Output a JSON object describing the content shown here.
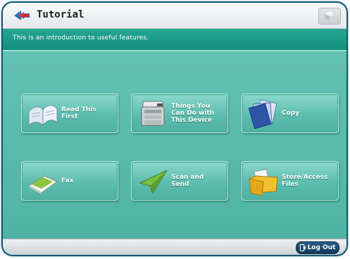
{
  "window": {
    "title": "Tutorial",
    "title_icon": "tutorial-pointer-icon",
    "settings_icon": "settings-cube-icon"
  },
  "info": {
    "text": "This is an introduction to useful features."
  },
  "tiles": [
    {
      "label": "Read This\nFirst",
      "icon": "open-book-icon"
    },
    {
      "label": "Things You\nCan Do with\nThis Device",
      "icon": "multifunction-printer-icon"
    },
    {
      "label": "Copy",
      "icon": "document-stack-icon"
    },
    {
      "label": "Fax",
      "icon": "fax-paper-icon"
    },
    {
      "label": "Scan and\nSend",
      "icon": "paper-plane-icon"
    },
    {
      "label": "Store/Access\nFiles",
      "icon": "folder-box-icon"
    }
  ],
  "footer": {
    "logout_label": "Log Out",
    "logout_icon": "logout-door-icon"
  },
  "colors": {
    "panel": "#5cbcae",
    "info_bar": "#1b9b89",
    "tile": "#6fcbbd",
    "logout": "#1d4a6f"
  }
}
